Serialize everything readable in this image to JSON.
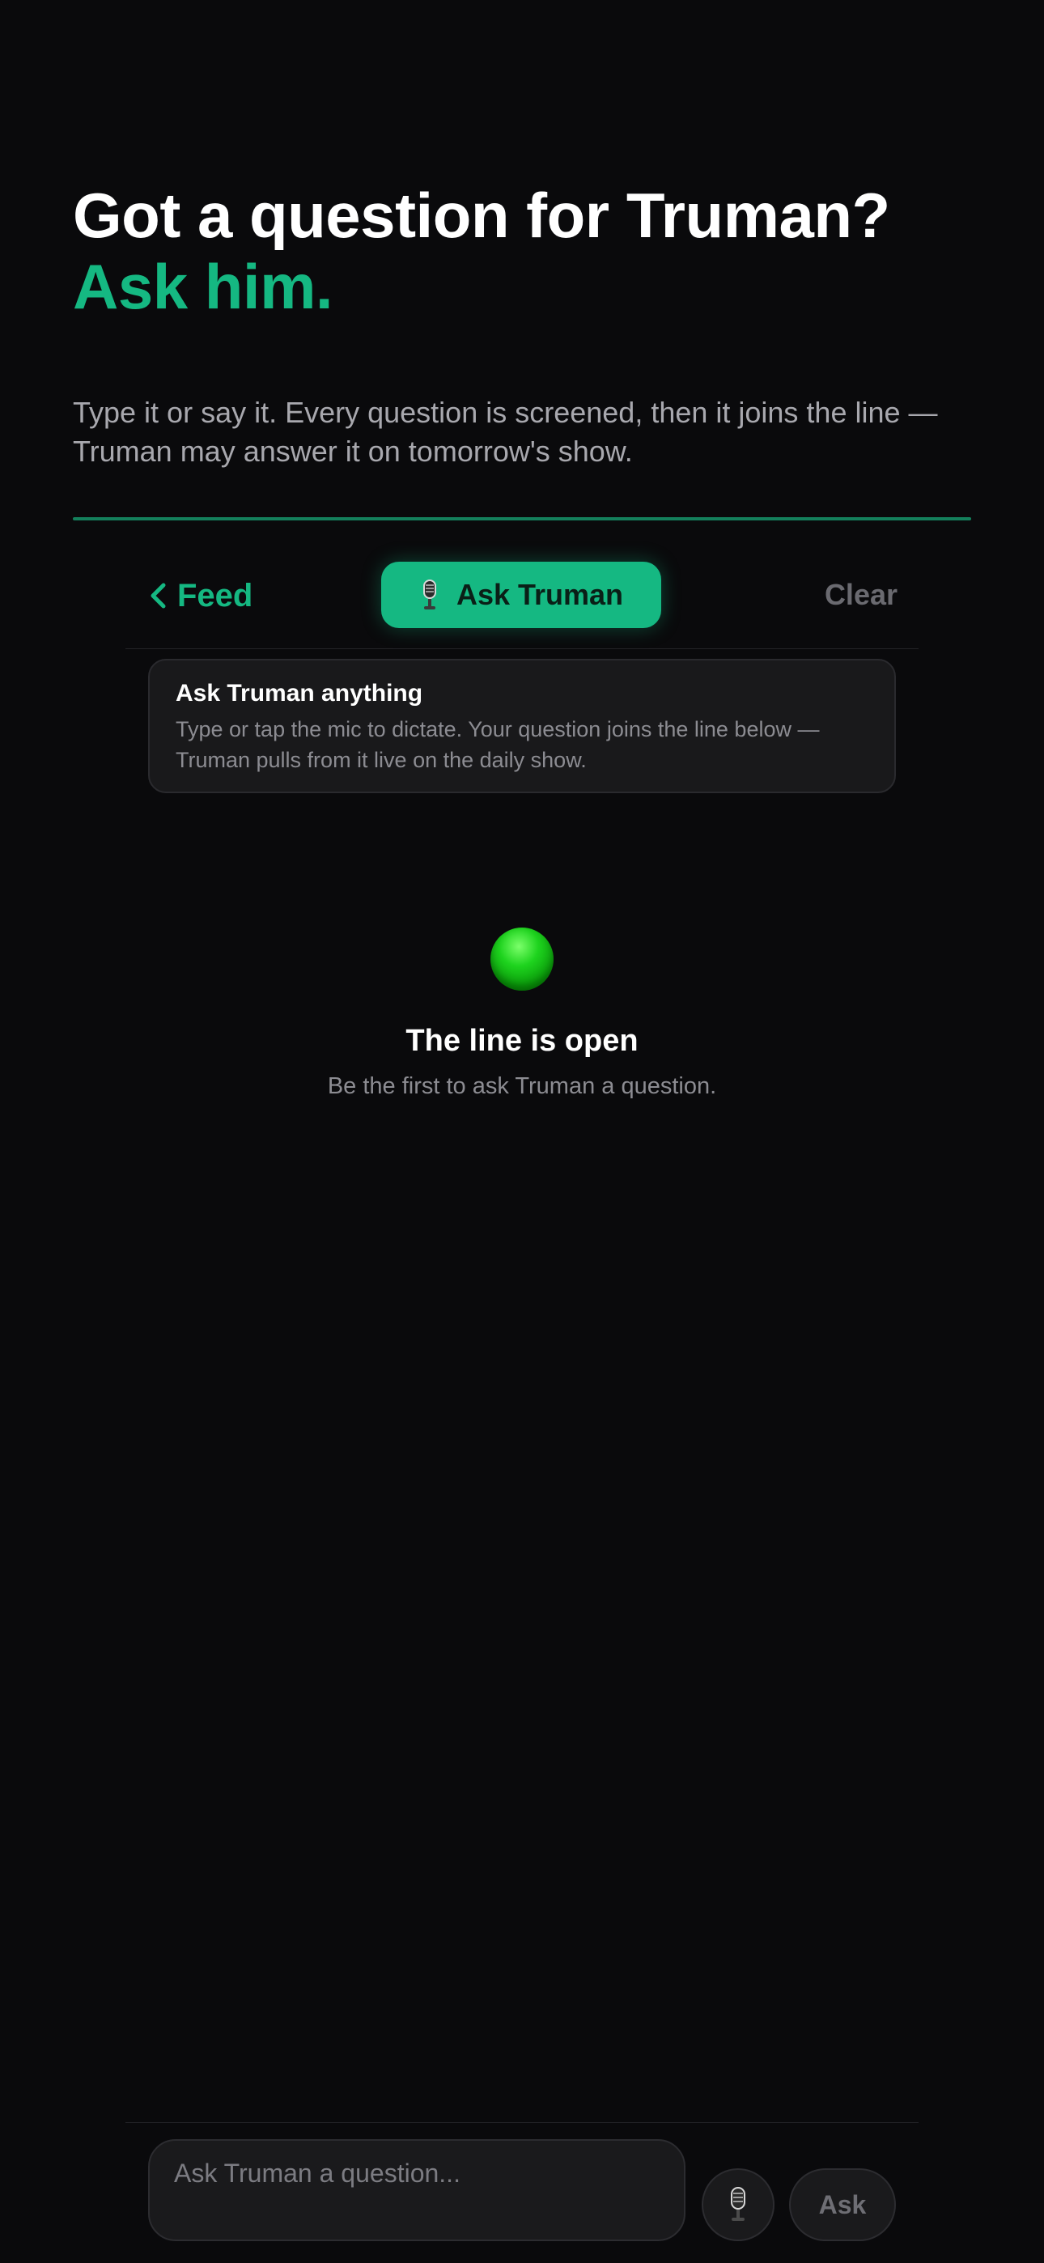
{
  "hero": {
    "title": "Got a question for Truman?",
    "accent": "Ask him.",
    "subtitle": "Type it or say it. Every question is screened, then it joins the line — Truman may answer it on tomorrow's show."
  },
  "toolbar": {
    "back_label": "Feed",
    "tab_label": "Ask Truman",
    "tab_icon": "microphone-icon",
    "clear_label": "Clear"
  },
  "info_card": {
    "title": "Ask Truman anything",
    "body": "Type or tap the mic to dictate. Your question joins the line below — Truman pulls from it live on the daily show."
  },
  "empty_state": {
    "icon": "green-circle-icon",
    "title": "The line is open",
    "subtitle": "Be the first to ask Truman a question."
  },
  "composer": {
    "placeholder": "Ask Truman a question...",
    "mic_icon": "microphone-icon",
    "send_label": "Ask"
  },
  "colors": {
    "background": "#0a0a0c",
    "accent": "#15b882",
    "muted_text": "#8c8c92",
    "card": "#19191b"
  }
}
